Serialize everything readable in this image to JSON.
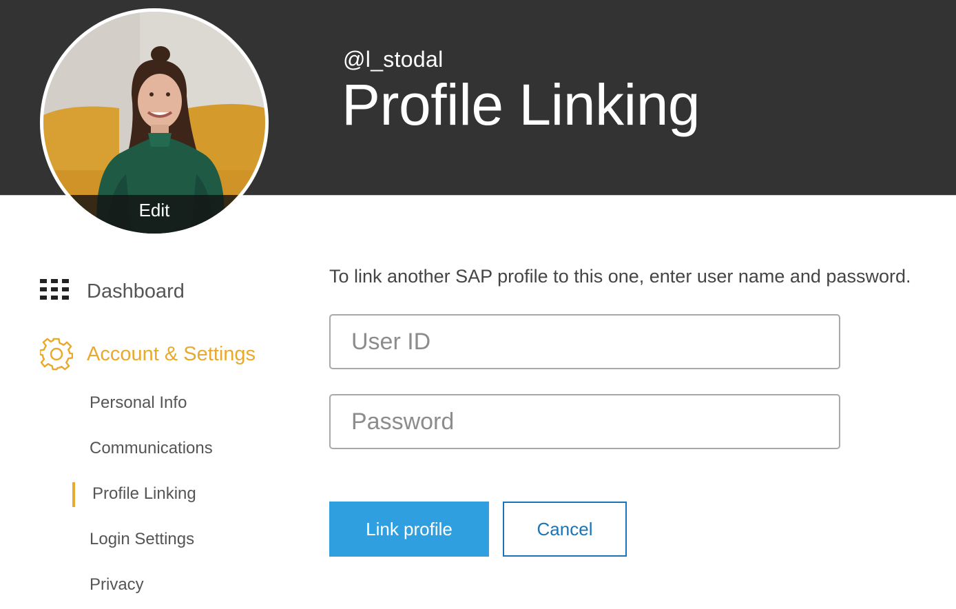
{
  "header": {
    "handle": "@l_stodal",
    "title": "Profile Linking"
  },
  "avatar": {
    "edit_label": "Edit"
  },
  "sidebar": {
    "items": [
      {
        "label": "Dashboard",
        "icon": "grid-icon",
        "active": false
      },
      {
        "label": "Account & Settings",
        "icon": "gear-icon",
        "active": true
      }
    ],
    "subitems": [
      {
        "label": "Personal Info",
        "active": false
      },
      {
        "label": "Communications",
        "active": false
      },
      {
        "label": "Profile Linking",
        "active": true
      },
      {
        "label": "Login Settings",
        "active": false
      },
      {
        "label": "Privacy",
        "active": false
      }
    ]
  },
  "main": {
    "intro": "To link another SAP profile to this one, enter user name and password.",
    "user_id": {
      "placeholder": "User ID",
      "value": ""
    },
    "password": {
      "placeholder": "Password",
      "value": ""
    },
    "link_button": "Link profile",
    "cancel_button": "Cancel"
  },
  "colors": {
    "header_bg": "#333333",
    "accent": "#e9a92c",
    "primary": "#2f9fe0",
    "link": "#1a74b6"
  }
}
